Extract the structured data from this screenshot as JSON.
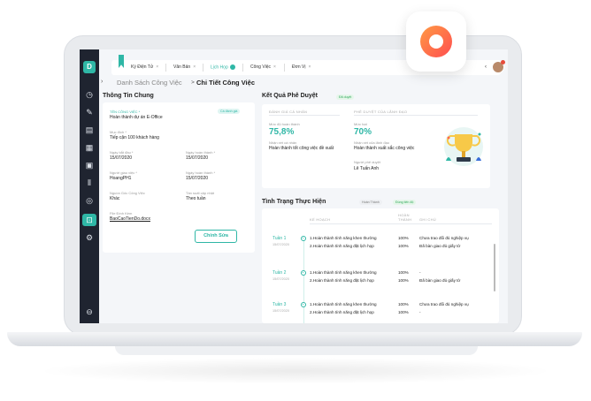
{
  "sidebar": {
    "logo": "D"
  },
  "tabs": [
    {
      "label": "Ký Điện Tử",
      "close": "×"
    },
    {
      "label": "Văn Bản",
      "close": "×"
    },
    {
      "label": "Lịch Họp",
      "close": ""
    },
    {
      "label": "Công Việc",
      "close": "×"
    },
    {
      "label": "Đơn Vị",
      "close": "×"
    }
  ],
  "breadcrumb": {
    "previous": "Danh Sách Công Việc",
    "separator": ">",
    "current": "Chi Tiết Công Việc"
  },
  "general": {
    "title": "Thông Tin Chung",
    "status_badge": "Cá đánh giá",
    "task_name_label": "TÊN CÔNG VIỆC *",
    "task_name": "Hoàn thành dự án E-Office",
    "goal_label": "Mục đích *",
    "goal": "Tiếp cận 100 khách hàng",
    "start_label": "Ngày bắt đầu *",
    "start": "15/07/2020",
    "due_label": "Ngày hoàn thành *",
    "due": "15/07/2020",
    "assigner_label": "Người giao việc *",
    "assigner": "HoangPH1",
    "done_label": "Ngày hoàn thành *",
    "done": "15/07/2020",
    "source_label": "Nguồn Gốc Công Việc",
    "source": "Khác",
    "frequency_label": "Tần suất cập nhật",
    "frequency": "Theo tuần",
    "attach_label": "File Đính Kèm",
    "attach": "BaoCaoTienDo.docx",
    "edit_button": "Chỉnh Sửa"
  },
  "approval": {
    "title": "Kết Quả Phê Duyệt",
    "badge": "Đã duyệt",
    "self_header": "ĐÁNH GIÁ CÁ NHÂN",
    "leader_header": "PHÊ DUYỆT CỦA LÃNH ĐẠO",
    "self_level_label": "Mức độ hoàn thành",
    "self_level": "75,8%",
    "self_comment_label": "Nhận xét cá nhân",
    "self_comment": "Hoàn thành tốt công việc đề xuất",
    "leader_level_label": "Mức hạt",
    "leader_level": "70%",
    "leader_comment_label": "Nhận xét của lãnh đạo",
    "leader_comment": "Hoàn thành xuất sắc công việc",
    "approver_label": "Người phê duyệt",
    "approver": "Lê Tuấn Anh",
    "trophy_icon": "trophy-icon"
  },
  "progress": {
    "title": "Tình Trạng Thực Hiện",
    "badge_plan": "Hoàn Thành",
    "badge_actual": "Đúng tiến độ",
    "col_plan": "KẾ HOẠCH",
    "col_done": "HOÀN THÀNH",
    "col_note": "GHI CHÚ",
    "weeks": [
      {
        "label": "Tuần 1",
        "date": "15/07/2020",
        "rows": [
          {
            "plan": "1.Hoàn thành tính năng khen thưởng",
            "done": "100%",
            "note": "Chưa trao đổi đủ nghiệp vụ"
          },
          {
            "plan": "2.Hoàn thành tính năng đặt lịch họp",
            "done": "100%",
            "note": "Đã bàn giao đủ giấy tờ"
          }
        ]
      },
      {
        "label": "Tuần 2",
        "date": "15/07/2020",
        "rows": [
          {
            "plan": "1.Hoàn thành tính năng khen thưởng",
            "done": "100%",
            "note": "-"
          },
          {
            "plan": "2.Hoàn thành tính năng đặt lịch họp",
            "done": "100%",
            "note": "Đã bàn giao đủ giấy tờ"
          }
        ]
      },
      {
        "label": "Tuần 3",
        "date": "15/07/2020",
        "rows": [
          {
            "plan": "1.Hoàn thành tính năng khen thưởng",
            "done": "100%",
            "note": "Chưa trao đổi đủ nghiệp vụ"
          },
          {
            "plan": "2.Hoàn thành tính năng đặt lịch họp",
            "done": "100%",
            "note": "-"
          }
        ]
      }
    ]
  },
  "colors": {
    "accent": "#2fb7a6",
    "sidebar": "#1f2430",
    "app_icon": "#ff6b4a"
  }
}
